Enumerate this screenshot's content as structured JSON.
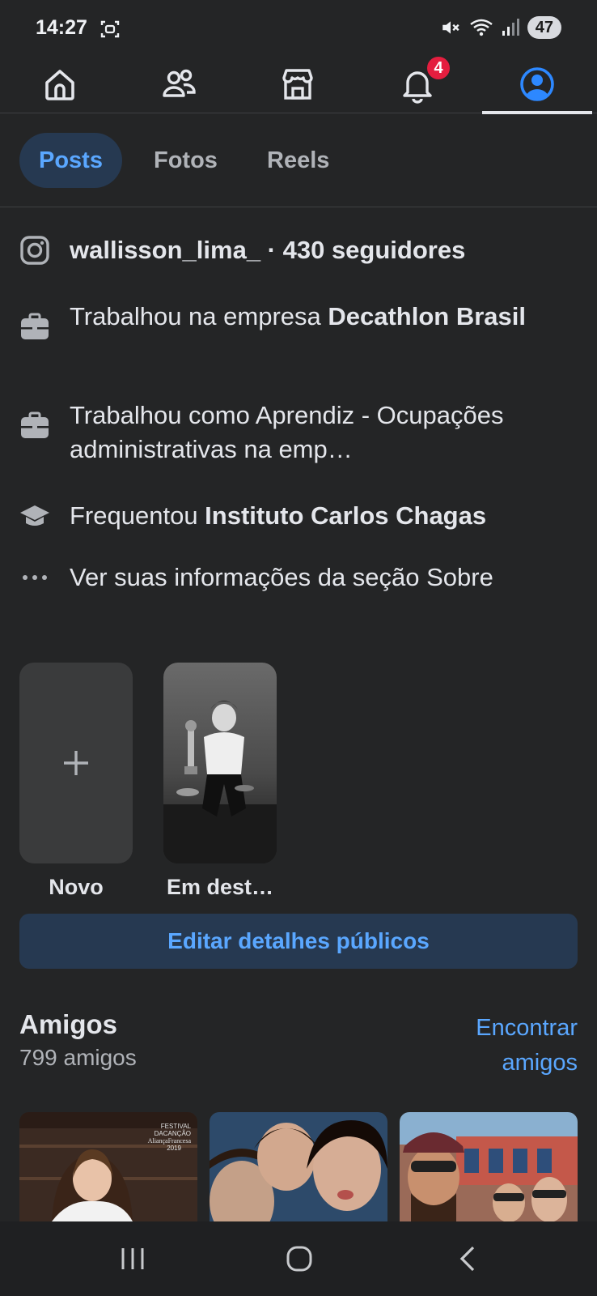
{
  "status_bar": {
    "time": "14:27",
    "battery": "47"
  },
  "nav": {
    "notifications_badge": "4"
  },
  "tabs": [
    {
      "label": "Posts",
      "active": true
    },
    {
      "label": "Fotos",
      "active": false
    },
    {
      "label": "Reels",
      "active": false
    }
  ],
  "intro": {
    "instagram": {
      "text": "wallisson_lima_ · 430 seguidores"
    },
    "work1": {
      "prefix": "Trabalhou na empresa ",
      "bold": "Decathlon Brasil"
    },
    "work2": {
      "text": "Trabalhou como Aprendiz - Ocupações administrativas na emp…"
    },
    "education": {
      "prefix": "Frequentou ",
      "bold": "Instituto Carlos Chagas"
    },
    "about": {
      "text": "Ver suas informações da seção Sobre"
    }
  },
  "highlights": {
    "new_label": "Novo",
    "featured_label": "Em dest…"
  },
  "edit_button": "Editar detalhes públicos",
  "friends": {
    "title": "Amigos",
    "count": "799 amigos",
    "find_line1": "Encontrar",
    "find_line2": "amigos",
    "photo1_caption_line1": "FESTIVAL",
    "photo1_caption_line2": "DACANÇÃO",
    "photo1_caption_line3": "AliançaFrancesa",
    "photo1_caption_line4": "2019"
  },
  "colors": {
    "accent": "#5aa7ff",
    "background": "#242526",
    "badge": "#e41e3f"
  }
}
